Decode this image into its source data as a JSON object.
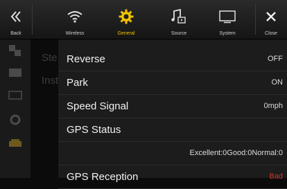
{
  "topbar": {
    "back_label": "Back",
    "close_label": "Close",
    "tabs": [
      {
        "label": "Wireless",
        "icon": "wifi-icon"
      },
      {
        "label": "General",
        "icon": "gear-icon",
        "active": true
      },
      {
        "label": "Source",
        "icon": "music-note-icon"
      },
      {
        "label": "System",
        "icon": "monitor-icon"
      }
    ]
  },
  "background": {
    "items": [
      "Ste",
      "Inst"
    ]
  },
  "rows": [
    {
      "label": "Reverse",
      "value": "OFF"
    },
    {
      "label": "Park",
      "value": "ON"
    },
    {
      "label": "Speed Signal",
      "value": "0mph"
    },
    {
      "label": "GPS Status",
      "value": ""
    },
    {
      "label": "",
      "value": "Excellent:0Good:0Normal:0"
    },
    {
      "label": "GPS Reception",
      "value": "Bad"
    }
  ],
  "colors": {
    "accent": "#f2c200",
    "bad": "#d4332a"
  }
}
